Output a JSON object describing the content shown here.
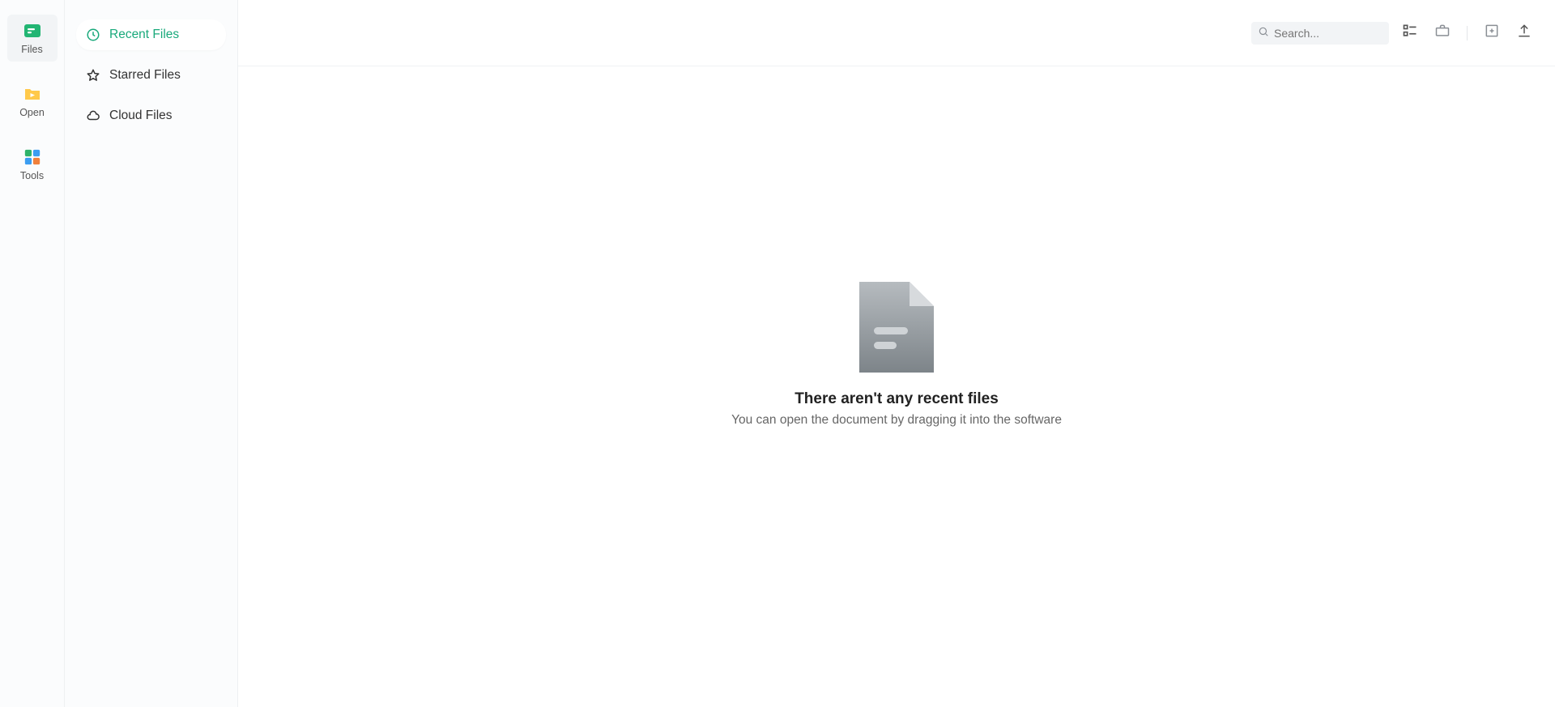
{
  "nav": {
    "items": [
      {
        "label": "Files"
      },
      {
        "label": "Open"
      },
      {
        "label": "Tools"
      }
    ]
  },
  "sidebar": {
    "items": [
      {
        "label": "Recent Files"
      },
      {
        "label": "Starred Files"
      },
      {
        "label": "Cloud Files"
      }
    ]
  },
  "search": {
    "placeholder": "Search..."
  },
  "empty": {
    "title": "There aren't any recent files",
    "subtitle": "You can open the document by dragging it into the software"
  }
}
